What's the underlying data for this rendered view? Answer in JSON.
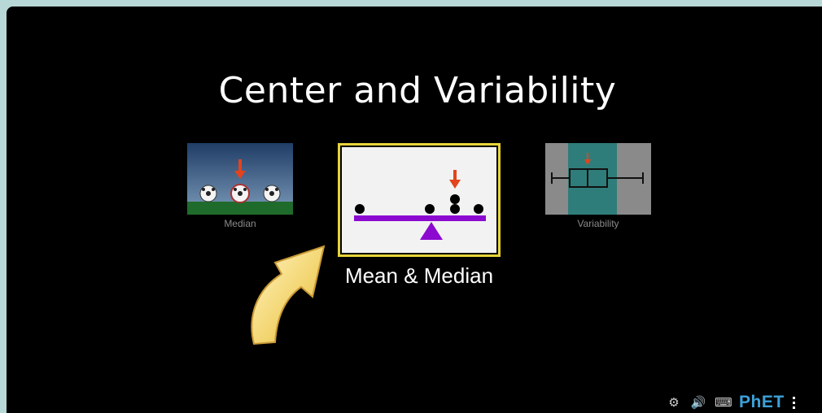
{
  "app": {
    "title": "Center and Variability"
  },
  "screens": [
    {
      "label": "Median",
      "selected": false
    },
    {
      "label": "Mean & Median",
      "selected": true
    },
    {
      "label": "Variability",
      "selected": false
    }
  ],
  "toolbar": {
    "icons": [
      "gear-icon",
      "speaker-icon",
      "keyboard-icon"
    ],
    "brand": "PhET"
  },
  "colors": {
    "background": "#000000",
    "selected_border": "#e7d43a",
    "balance_beam": "#8c0ad0",
    "arrow_red": "#e3431c",
    "field_green": "#1f6b2c"
  }
}
